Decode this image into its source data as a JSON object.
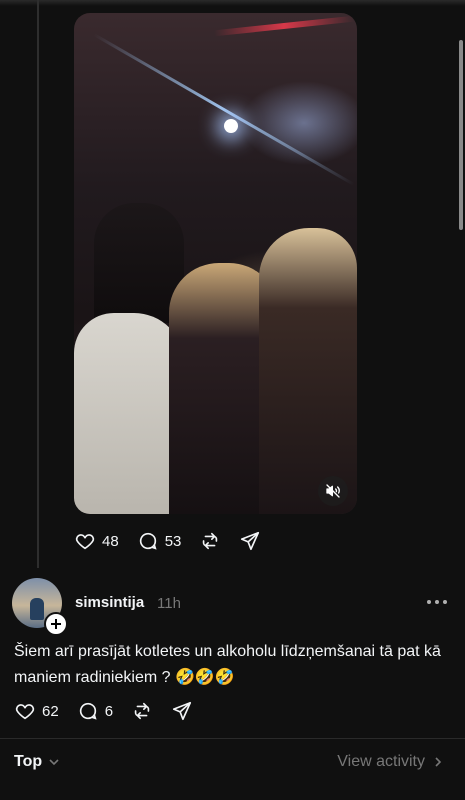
{
  "video": {
    "muted": true
  },
  "post1": {
    "likes": "48",
    "replies": "53"
  },
  "post2": {
    "username": "simsintija",
    "time": "11h",
    "text": "Šiem arī prasījāt kotletes un alkoholu līdzņemšanai tā pat kā maniem radiniekiem ? 🤣🤣🤣",
    "likes": "62",
    "replies": "6"
  },
  "footer": {
    "sort_label": "Top",
    "view_activity": "View activity"
  },
  "icons": {
    "like": "heart-icon",
    "reply": "comment-icon",
    "repost": "repost-icon",
    "share": "send-icon",
    "mute": "speaker-muted-icon",
    "more": "more-dots-icon",
    "follow": "plus-icon",
    "sort": "chevron-down-icon",
    "activity": "chevron-right-icon"
  }
}
